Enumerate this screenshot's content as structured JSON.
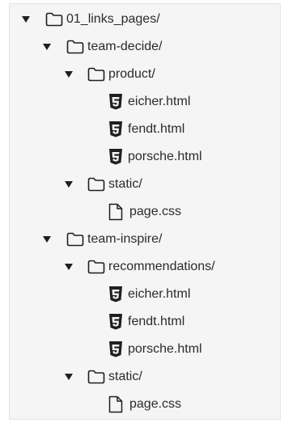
{
  "tree": {
    "root": {
      "name": "01_links_pages/",
      "icon": "folder-icon",
      "expanded": true,
      "children": {
        "team_decide": {
          "name": "team-decide/",
          "icon": "folder-icon",
          "expanded": true,
          "product": {
            "name": "product/",
            "icon": "folder-icon",
            "expanded": true,
            "files": [
              "eicher.html",
              "fendt.html",
              "porsche.html"
            ],
            "file_icon": "html5-icon"
          },
          "static": {
            "name": "static/",
            "icon": "folder-icon",
            "expanded": true,
            "files": [
              "page.css"
            ],
            "file_icon": "file-icon"
          }
        },
        "team_inspire": {
          "name": "team-inspire/",
          "icon": "folder-icon",
          "expanded": true,
          "recommendations": {
            "name": "recommendations/",
            "icon": "folder-icon",
            "expanded": true,
            "files": [
              "eicher.html",
              "fendt.html",
              "porsche.html"
            ],
            "file_icon": "html5-icon"
          },
          "static": {
            "name": "static/",
            "icon": "folder-icon",
            "expanded": true,
            "files": [
              "page.css"
            ],
            "file_icon": "file-icon"
          }
        }
      }
    }
  },
  "colors": {
    "text": "#2b2b2b",
    "icon": "#1f1f1f",
    "panel_background": "#f5f5f5",
    "panel_border": "#e4e4e4"
  }
}
